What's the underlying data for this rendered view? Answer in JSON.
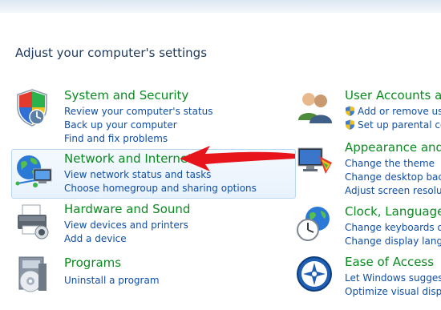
{
  "page": {
    "title": "Adjust your computer's settings"
  },
  "categories": [
    {
      "id": "system",
      "title": "System and Security",
      "links": [
        "Review your computer's status",
        "Back up your computer",
        "Find and fix problems"
      ]
    },
    {
      "id": "network",
      "title": "Network and Internet",
      "links": [
        "View network status and tasks",
        "Choose homegroup and sharing options"
      ]
    },
    {
      "id": "hardware",
      "title": "Hardware and Sound",
      "links": [
        "View devices and printers",
        "Add a device"
      ]
    },
    {
      "id": "programs",
      "title": "Programs",
      "links": [
        "Uninstall a program"
      ]
    },
    {
      "id": "users",
      "title": "User Accounts an",
      "links": [
        "Add or remove user",
        "Set up parental cont"
      ]
    },
    {
      "id": "appearance",
      "title": "Appearance and P",
      "links": [
        "Change the theme",
        "Change desktop backg",
        "Adjust screen resolutio"
      ]
    },
    {
      "id": "clock",
      "title": "Clock, Language,",
      "links": [
        "Change keyboards or o",
        "Change display langua"
      ]
    },
    {
      "id": "access",
      "title": "Ease of Access",
      "links": [
        "Let Windows suggest s",
        "Optimize visual display"
      ]
    }
  ],
  "annotation": {
    "arrow_color": "#e8141b"
  },
  "icons": {
    "system": "shield-icon",
    "network": "network-globe-icon",
    "hardware": "printer-icon",
    "programs": "programs-box-icon",
    "users": "users-icon",
    "appearance": "monitor-palette-icon",
    "clock": "clock-globe-icon",
    "access": "ease-of-access-icon",
    "uac": "uac-shield-icon"
  }
}
